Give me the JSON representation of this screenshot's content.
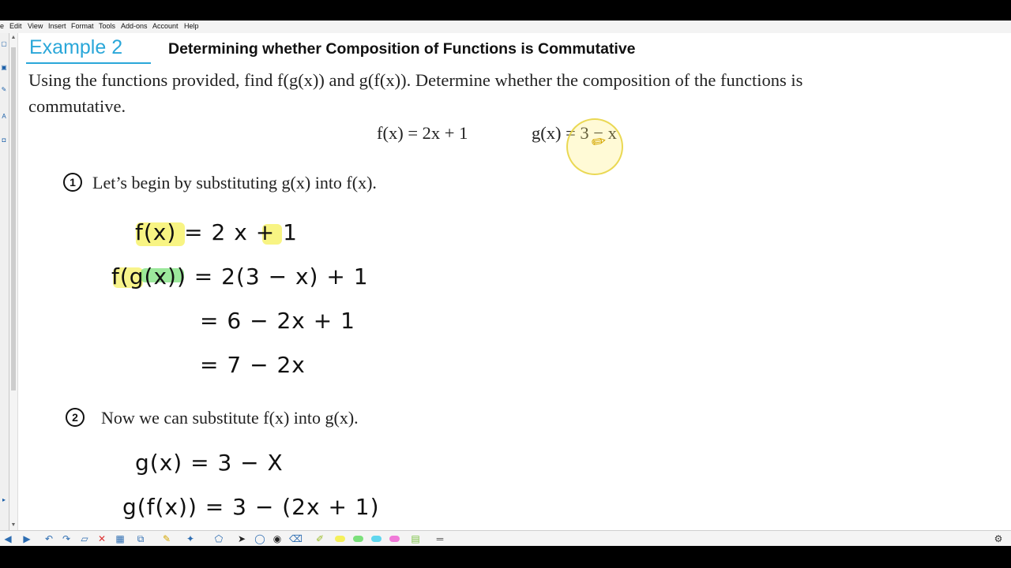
{
  "menu": [
    "e",
    "Edit",
    "View",
    "Insert",
    "Format",
    "Tools",
    "Add-ons",
    "Account",
    "Help"
  ],
  "example": {
    "label": "Example 2",
    "heading": "Determining whether Composition of Functions is Commutative",
    "accent_color": "#2aa7d9"
  },
  "problem": {
    "line1": "Using the functions provided, find f(g(x)) and g(f(x)). Determine whether the composition of the functions is",
    "line2": "commutative.",
    "f_def": "f(x) = 2x + 1",
    "g_def": "g(x) = 3 − x"
  },
  "step1": {
    "number": "1",
    "text": "Let’s begin by substituting g(x) into f(x).",
    "lines": [
      "f(x)  =  2  x   +  1",
      "f(g(x)) = 2(3 − x) + 1",
      "= 6 − 2x + 1",
      "= 7 − 2x"
    ]
  },
  "step2": {
    "number": "2",
    "text": "Now we can substitute f(x) into g(x).",
    "lines": [
      "g(x)  =  3  −  X",
      "g(f(x)) = 3 − (2x + 1)"
    ]
  },
  "highlight_colors": {
    "yellow": "#f5f05a",
    "green": "#7be07b"
  },
  "toolbar": {
    "icons": [
      "left-arrow-icon",
      "right-arrow-icon",
      "undo-icon",
      "redo-icon",
      "screen-icon",
      "delete-icon",
      "table-icon",
      "screen-capture-icon",
      "pen-tool-icon",
      "magic-pen-icon",
      "select-icon",
      "lasso-icon",
      "fill-icon",
      "eraser-icon",
      "yellow-highlighter-icon",
      "green-highlighter-icon",
      "cyan-highlighter-icon",
      "pink-highlighter-icon",
      "grid-icon",
      "line-icon",
      "settings-icon"
    ]
  }
}
